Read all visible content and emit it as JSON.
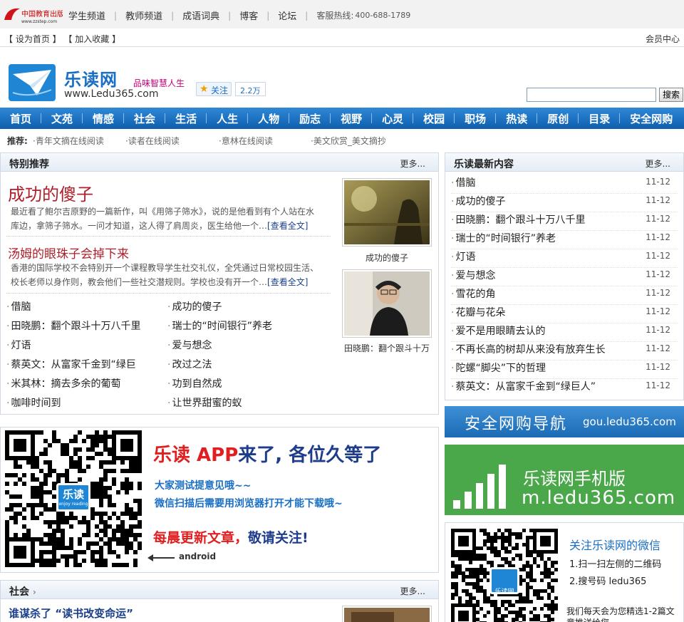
{
  "site": {
    "logo_text": "中国教育出版网",
    "logo_sub": "www.zzstep.com",
    "top_nav": [
      "学生频道",
      "教师频道",
      "成语词典",
      "博客",
      "论坛"
    ],
    "hotline_label": "客服热线:",
    "hotline": "400-688-1789",
    "set_home": "【 设为首页 】",
    "add_fav": "【 加入收藏 】",
    "member": "会员中心"
  },
  "brand": {
    "name": "乐读网",
    "url": "www.Ledu365.com",
    "slogan": "品味智慧人生",
    "follow": "关注",
    "follow_count": "2.2万",
    "search_btn": "搜索"
  },
  "main_nav": [
    "首页",
    "文苑",
    "情感",
    "社会",
    "生活",
    "人生",
    "人物",
    "励志",
    "视野",
    "心灵",
    "校园",
    "职场",
    "热读",
    "原创",
    "目录",
    "安全网购"
  ],
  "recommend": {
    "label": "推荐:",
    "items": [
      "·青年文摘在线阅读",
      "·读者在线阅读",
      "·意林在线阅读",
      "·美文欣赏_美文摘抄"
    ]
  },
  "featured": {
    "title": "特别推荐",
    "more": "更多...",
    "a1_title": "成功的傻子",
    "a1_desc_1": "最近看了鲍尔吉原野的一篇新作，叫《用筛子筛水》，说的是他看到有个人站在水",
    "a1_desc_2": "库边，拿筛子筛水。一问才知道，这人得了肩周炎，医生给他一个…",
    "a2_title": "汤姆的眼珠子会掉下来",
    "a2_desc_1": "香港的国际学校不会特别开一个课程教导学生社交礼仪，全凭通过日常校园生活、",
    "a2_desc_2": "校长老师以身作则，教会他们一些社交潜规则。学校也没有开一个…",
    "read_more": "[查看全文]",
    "img1_caption": "成功的傻子",
    "img2_caption": "田晓鹏：翻个跟斗十万",
    "left_links": [
      "借脑",
      "田晓鹏：翻个跟斗十万八千里",
      "灯语",
      "蔡英文：从富家千金到“绿巨",
      "米其林：摘去多余的葡萄",
      "咖啡时间到"
    ],
    "right_links": [
      "成功的傻子",
      "瑞士的“时间银行”养老",
      "爱与想念",
      "改过之法",
      "功到自然成",
      "让世界甜蜜的蚁"
    ]
  },
  "latest": {
    "title": "乐读最新内容",
    "more": "更多...",
    "items": [
      {
        "title": "借脑",
        "date": "11-12"
      },
      {
        "title": "成功的傻子",
        "date": "11-12"
      },
      {
        "title": "田晓鹏：翻个跟斗十万八千里",
        "date": "11-12"
      },
      {
        "title": "瑞士的“时间银行”养老",
        "date": "11-12"
      },
      {
        "title": "灯语",
        "date": "11-12"
      },
      {
        "title": "爱与想念",
        "date": "11-12"
      },
      {
        "title": "雪花的角",
        "date": "11-12"
      },
      {
        "title": "花瓣与花朵",
        "date": "11-12"
      },
      {
        "title": "爱不是用眼睛去认的",
        "date": "11-12"
      },
      {
        "title": "不再长高的树却从来没有放弃生长",
        "date": "11-12"
      },
      {
        "title": "陀螺“脚尖”下的哲理",
        "date": "11-12"
      },
      {
        "title": "蔡英文：从富家千金到“绿巨人”",
        "date": "11-12"
      }
    ]
  },
  "app": {
    "title_red": "乐读 APP",
    "title_rest": "来了, 各位久等了",
    "line1": "大家测试提意见哦~~",
    "line2": "微信扫描后需要用浏览器打开才能下载哦~",
    "line3_red": "每晨更新文章，",
    "line3_blue": "敬请关注!",
    "android": "android",
    "qr_badge": "乐读",
    "qr_badge_sub": "enjoy reading"
  },
  "banners": {
    "gou_title": "安全网购导航",
    "gou_url": "gou.ledu365.com",
    "mobile_title": "乐读网手机版",
    "mobile_url": "m.ledu365.com"
  },
  "wechat": {
    "title": "关注乐读网的微信",
    "step1": "1.扫一扫左侧的二维码",
    "step2": "2.搜号码 ledu365",
    "note": "我们每天会为您精选1-2篇文章推送给您",
    "qr_badge": "乐读网"
  },
  "shehui": {
    "title": "社会",
    "more": "更多...",
    "first": "谁谋杀了 “读书改变命运”"
  },
  "colors": {
    "nav": "#1a6fc4",
    "red": "#b0202b",
    "green": "#4aa84a"
  }
}
